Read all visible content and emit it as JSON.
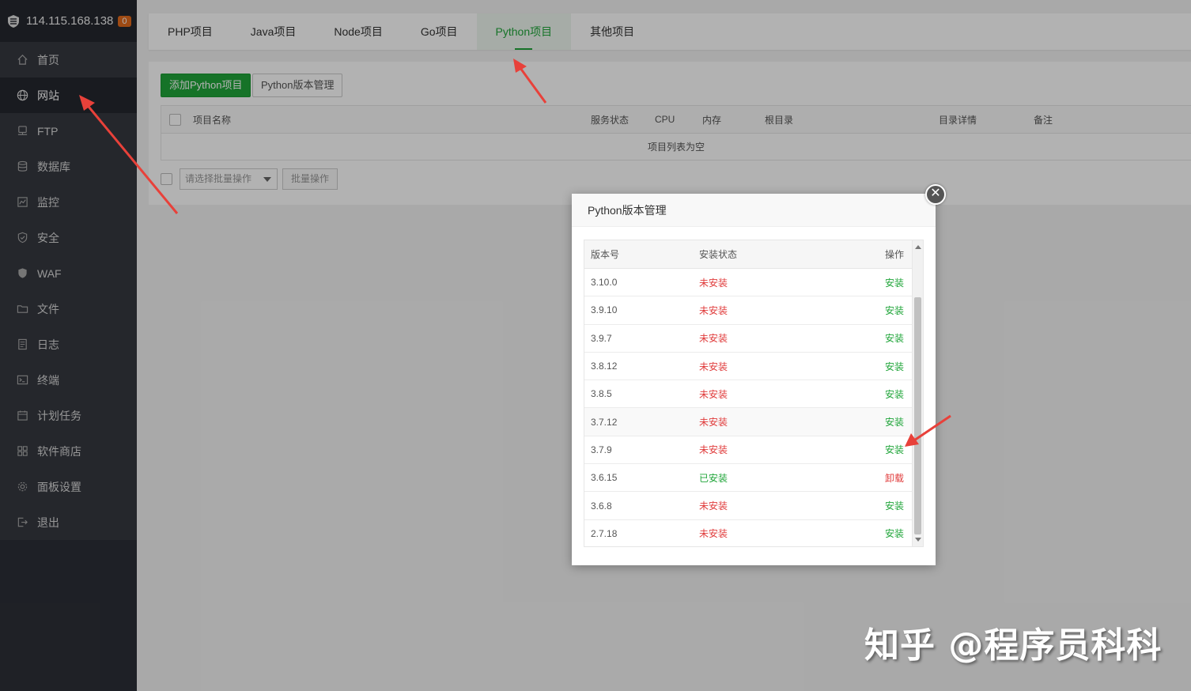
{
  "sidebar": {
    "server_ip": "114.115.168.138",
    "badge_count": "0",
    "items": [
      {
        "label": "首页",
        "icon": "home-icon"
      },
      {
        "label": "网站",
        "icon": "globe-icon",
        "active": true
      },
      {
        "label": "FTP",
        "icon": "ftp-icon"
      },
      {
        "label": "数据库",
        "icon": "database-icon"
      },
      {
        "label": "监控",
        "icon": "monitor-icon"
      },
      {
        "label": "安全",
        "icon": "shield-check-icon"
      },
      {
        "label": "WAF",
        "icon": "waf-shield-icon"
      },
      {
        "label": "文件",
        "icon": "folder-icon"
      },
      {
        "label": "日志",
        "icon": "log-icon"
      },
      {
        "label": "终端",
        "icon": "terminal-icon"
      },
      {
        "label": "计划任务",
        "icon": "calendar-icon"
      },
      {
        "label": "软件商店",
        "icon": "apps-grid-icon"
      },
      {
        "label": "面板设置",
        "icon": "gear-icon"
      },
      {
        "label": "退出",
        "icon": "logout-icon"
      }
    ]
  },
  "tabs": [
    {
      "label": "PHP项目"
    },
    {
      "label": "Java项目"
    },
    {
      "label": "Node项目"
    },
    {
      "label": "Go项目"
    },
    {
      "label": "Python项目",
      "active": true
    },
    {
      "label": "其他项目"
    }
  ],
  "toolbar": {
    "add_label": "添加Python项目",
    "version_mgmt_label": "Python版本管理"
  },
  "project_table": {
    "columns": [
      "项目名称",
      "服务状态",
      "CPU",
      "内存",
      "根目录",
      "目录详情",
      "备注"
    ],
    "empty_text": "项目列表为空"
  },
  "batch": {
    "select_placeholder": "请选择批量操作",
    "button_label": "批量操作"
  },
  "dialog": {
    "title": "Python版本管理",
    "columns": {
      "version": "版本号",
      "status": "安装状态",
      "op": "操作"
    },
    "rows": [
      {
        "version": "3.10.0",
        "status": "未安装",
        "op": "安装",
        "installed": false
      },
      {
        "version": "3.9.10",
        "status": "未安装",
        "op": "安装",
        "installed": false
      },
      {
        "version": "3.9.7",
        "status": "未安装",
        "op": "安装",
        "installed": false
      },
      {
        "version": "3.8.12",
        "status": "未安装",
        "op": "安装",
        "installed": false
      },
      {
        "version": "3.8.5",
        "status": "未安装",
        "op": "安装",
        "installed": false
      },
      {
        "version": "3.7.12",
        "status": "未安装",
        "op": "安装",
        "installed": false
      },
      {
        "version": "3.7.9",
        "status": "未安装",
        "op": "安装",
        "installed": false
      },
      {
        "version": "3.6.15",
        "status": "已安装",
        "op": "卸载",
        "installed": true
      },
      {
        "version": "3.6.8",
        "status": "未安装",
        "op": "安装",
        "installed": false
      },
      {
        "version": "2.7.18",
        "status": "未安装",
        "op": "安装",
        "installed": false
      }
    ]
  },
  "watermark": "知乎 @程序员科科",
  "colors": {
    "accent": "#20a53a",
    "danger": "#e03b3b",
    "sidebar": "#2c2f37",
    "annotation_arrow": "#e8413a"
  }
}
